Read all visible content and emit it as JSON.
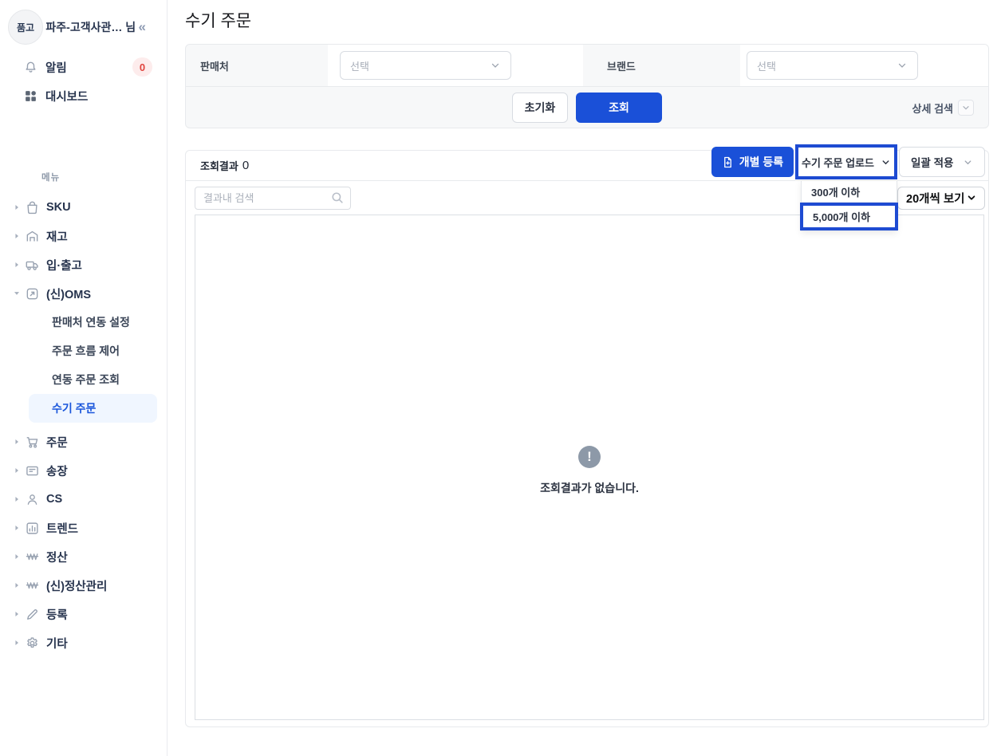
{
  "colors": {
    "primary": "#1a50d8",
    "annotation": "#1e4bd2",
    "active_text": "#1a56db",
    "active_bg": "#f0f6ff",
    "badge_bg": "#fdecec",
    "badge_text": "#e0443e"
  },
  "sidebar": {
    "logo": "품고",
    "user": "파주-고객사관… 님",
    "collapse": "«",
    "top_items": [
      {
        "label": "알림",
        "icon": "bell-icon",
        "badge": "0"
      },
      {
        "label": "대시보드",
        "icon": "dashboard-icon"
      }
    ],
    "menu_label": "메뉴",
    "menu": [
      {
        "label": "SKU",
        "icon": "bag-icon"
      },
      {
        "label": "재고",
        "icon": "warehouse-icon"
      },
      {
        "label": "입·출고",
        "icon": "truck-icon"
      },
      {
        "label": "(신)OMS",
        "icon": "link-icon",
        "expanded": true,
        "children": [
          "판매처 연동 설정",
          "주문 흐름 제어",
          "연동 주문 조회",
          "수기 주문"
        ],
        "active_child": "수기 주문"
      },
      {
        "label": "주문",
        "icon": "cart-icon"
      },
      {
        "label": "송장",
        "icon": "invoice-icon"
      },
      {
        "label": "CS",
        "icon": "person-icon"
      },
      {
        "label": "트렌드",
        "icon": "chart-icon"
      },
      {
        "label": "정산",
        "icon": "won-icon"
      },
      {
        "label": "(신)정산관리",
        "icon": "won-icon"
      },
      {
        "label": "등록",
        "icon": "pencil-icon"
      },
      {
        "label": "기타",
        "icon": "gear-icon"
      }
    ]
  },
  "header": {
    "title": "수기 주문"
  },
  "filters": {
    "fields": [
      {
        "label": "판매처",
        "value": "선택"
      },
      {
        "label": "브랜드",
        "value": "선택"
      }
    ],
    "reset_label": "초기화",
    "search_label": "조회",
    "advanced_label": "상세 검색"
  },
  "results": {
    "count_label": "조회결과",
    "count": "0",
    "individual_register_label": "개별 등록",
    "upload_label": "수기 주문 업로드",
    "bulk_apply_label": "일괄 적용",
    "upload_menu": [
      "300개 이하",
      "5,000개 이하"
    ],
    "highlighted_option": "5,000개 이하",
    "search_placeholder": "결과내 검색",
    "page_size_label": "20개씩 보기",
    "empty_message": "조회결과가 없습니다."
  }
}
